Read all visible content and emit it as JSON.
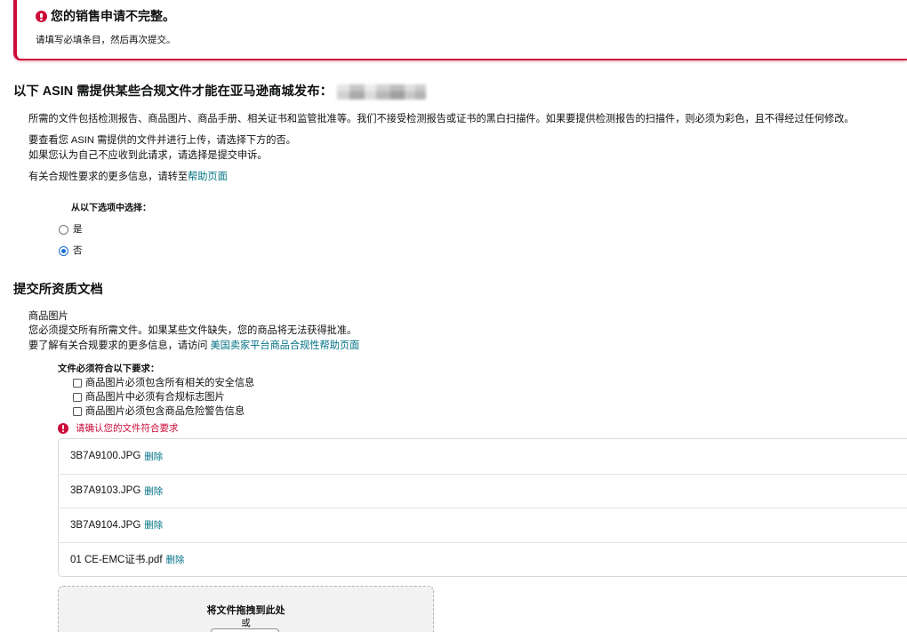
{
  "colors": {
    "error": "#cc0c39",
    "link": "#007185",
    "text": "#0f1111",
    "radio_selected": "#1a6fd1"
  },
  "icons": {
    "alert": "exclamation-circle-icon",
    "requirements_error": "exclamation-circle-icon"
  },
  "alert": {
    "title": "您的销售申请不完整。",
    "message": "请填写必填条目，然后再次提交。"
  },
  "asin_section": {
    "heading": "以下 ASIN 需提供某些合规文件才能在亚马逊商城发布：",
    "description": "所需的文件包括检测报告、商品图片、商品手册、相关证书和监管批准等。我们不接受检测报告或证书的黑白扫描件。如果要提供检测报告的扫描件，则必须为彩色，且不得经过任何修改。",
    "instruction_no": "要查看您 ASIN 需提供的文件并进行上传，请选择下方的否。",
    "instruction_yes": "如果您认为自己不应收到此请求，请选择是提交申诉。",
    "help_text": "有关合规性要求的更多信息，请转至",
    "help_link": "帮助页面"
  },
  "choice": {
    "label": "从以下选项中选择：",
    "options": [
      {
        "label": "是",
        "selected": false
      },
      {
        "label": "否",
        "selected": true
      }
    ]
  },
  "documents": {
    "heading": "提交所资质文档",
    "category": "商品图片",
    "note": "您必须提交所有所需文件。如果某些文件缺失，您的商品将无法获得批准。",
    "help_text": "要了解有关合规要求的更多信息，请访问 ",
    "help_link": "美国卖家平台商品合规性帮助页面",
    "requirements_title": "文件必须符合以下要求：",
    "requirements": [
      {
        "label": "商品图片必须包含所有相关的安全信息",
        "checked": false
      },
      {
        "label": "商品图片中必须有合规标志图片",
        "checked": false
      },
      {
        "label": "商品图片必须包含商品危险警告信息",
        "checked": false
      }
    ],
    "requirements_error": "请确认您的文件符合要求",
    "delete_label": "删除",
    "files": [
      {
        "name": "3B7A9100.JPG"
      },
      {
        "name": "3B7A9103.JPG"
      },
      {
        "name": "3B7A9104.JPG"
      },
      {
        "name": "01 CE-EMC证书.pdf"
      }
    ],
    "dropzone": {
      "title": "将文件拖拽到此处",
      "or": "或"
    }
  }
}
